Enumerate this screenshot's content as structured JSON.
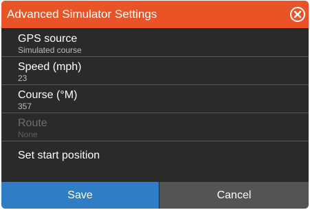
{
  "dialog": {
    "title": "Advanced Simulator Settings",
    "close_icon": "close-circle-icon",
    "accent_color": "#e85425"
  },
  "settings": [
    {
      "label": "GPS source",
      "value": "Simulated course",
      "enabled": true
    },
    {
      "label": "Speed (mph)",
      "value": "23",
      "enabled": true
    },
    {
      "label": "Course (°M)",
      "value": "357",
      "enabled": true
    },
    {
      "label": "Route",
      "value": "None",
      "enabled": false
    },
    {
      "label": "Set start position",
      "enabled": true
    }
  ],
  "buttons": {
    "save_label": "Save",
    "cancel_label": "Cancel",
    "save_color": "#2f7dc4",
    "cancel_color": "#545454"
  }
}
